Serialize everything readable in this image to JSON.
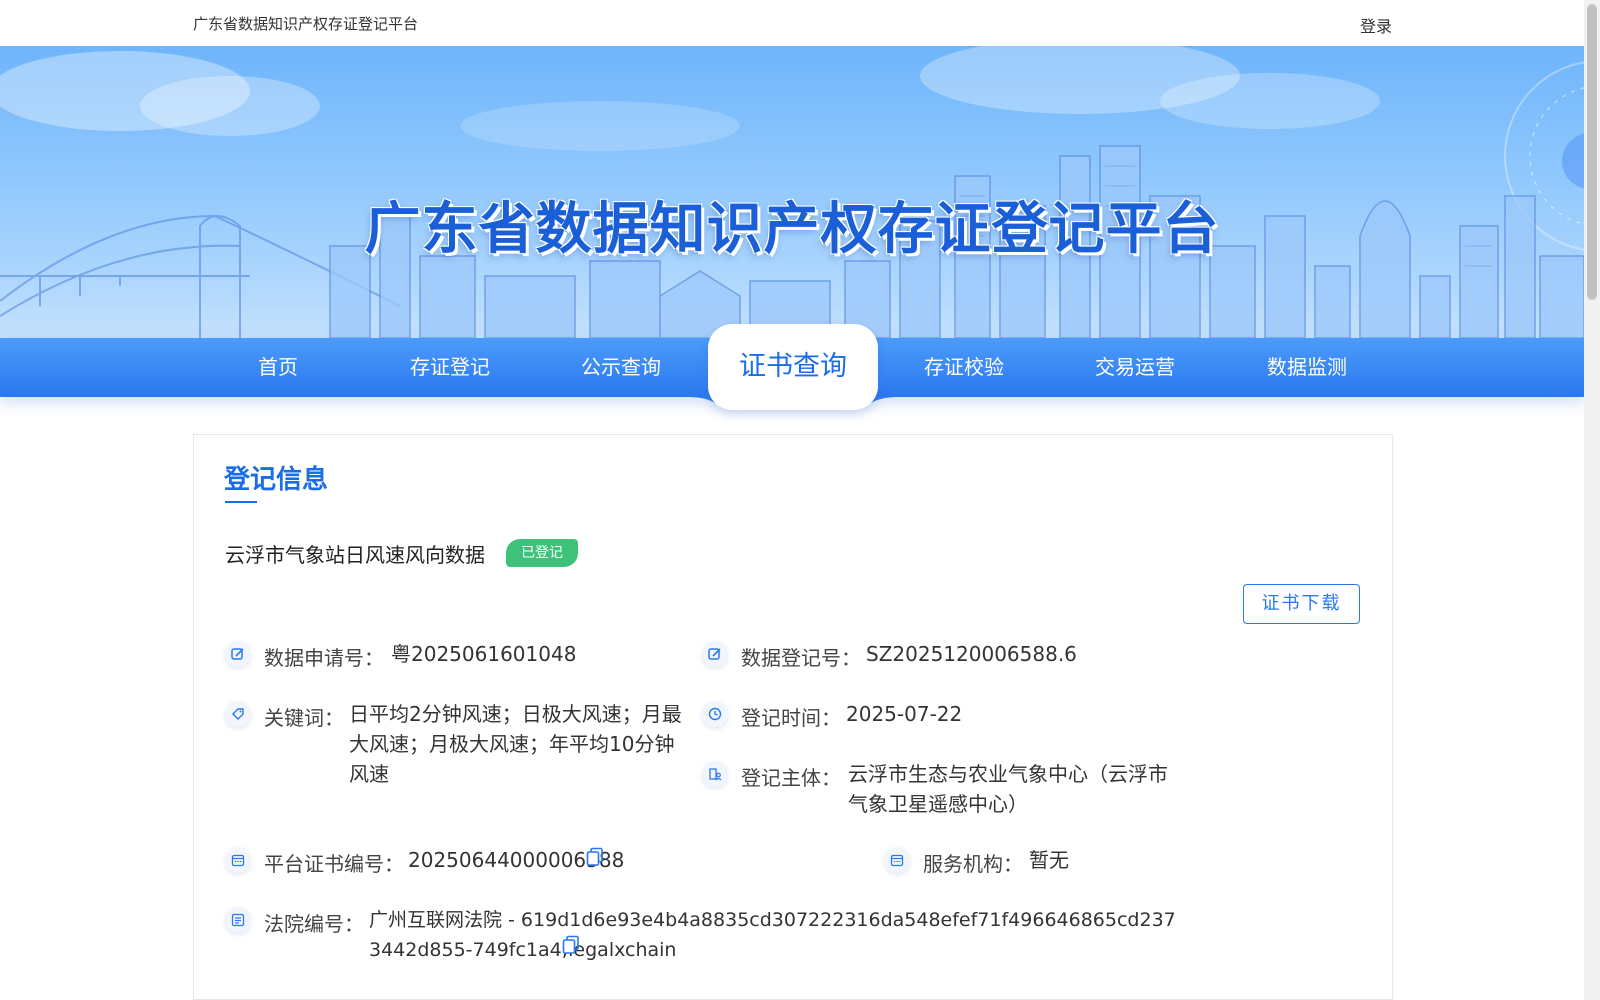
{
  "topbar": {
    "site_name": "广东省数据知识产权存证登记平台",
    "login": "登录"
  },
  "banner": {
    "title": "广东省数据知识产权存证登记平台"
  },
  "nav": {
    "items": [
      {
        "label": "首页"
      },
      {
        "label": "存证登记"
      },
      {
        "label": "公示查询"
      },
      {
        "label": "证书查询",
        "active": true
      },
      {
        "label": "存证校验"
      },
      {
        "label": "交易运营"
      },
      {
        "label": "数据监测"
      }
    ]
  },
  "record": {
    "section_title": "登记信息",
    "name": "云浮市气象站日风速风向数据",
    "status": "已登记",
    "download_label": "证书下载",
    "fields": {
      "apply_no": {
        "label": "数据申请号：",
        "value": "粤2025061601048",
        "icon": "edit-icon"
      },
      "register_no": {
        "label": "数据登记号：",
        "value": "SZ2025120006588.6",
        "icon": "edit-icon"
      },
      "keywords": {
        "label": "关键词：",
        "value": "日平均2分钟风速；日极大风速；月最大风速；月极大风速；年平均10分钟风速",
        "icon": "tag-icon"
      },
      "register_time": {
        "label": "登记时间：",
        "value": "2025-07-22",
        "icon": "clock-icon"
      },
      "register_subject": {
        "label": "登记主体：",
        "value": "云浮市生态与农业气象中心（云浮市气象卫星遥感中心）",
        "icon": "building-user-icon"
      },
      "cert_no": {
        "label": "平台证书编号：",
        "value": "20250644000006588",
        "icon": "calendar-icon"
      },
      "service_org": {
        "label": "服务机构：",
        "value": "暂无",
        "icon": "calendar-icon"
      },
      "court_no": {
        "label": "法院编号：",
        "value": "广州互联网法院 - 619d1d6e93e4b4a8835cd307222316da548efef71f496646865cd2373442d855-749fc1a4;legalxchain",
        "icon": "list-icon"
      }
    }
  },
  "colors": {
    "primary": "#1a6de8",
    "nav_gradient_top": "#4c9bfa",
    "nav_gradient_bottom": "#2a78ef",
    "status_green": "#3ec27a"
  }
}
